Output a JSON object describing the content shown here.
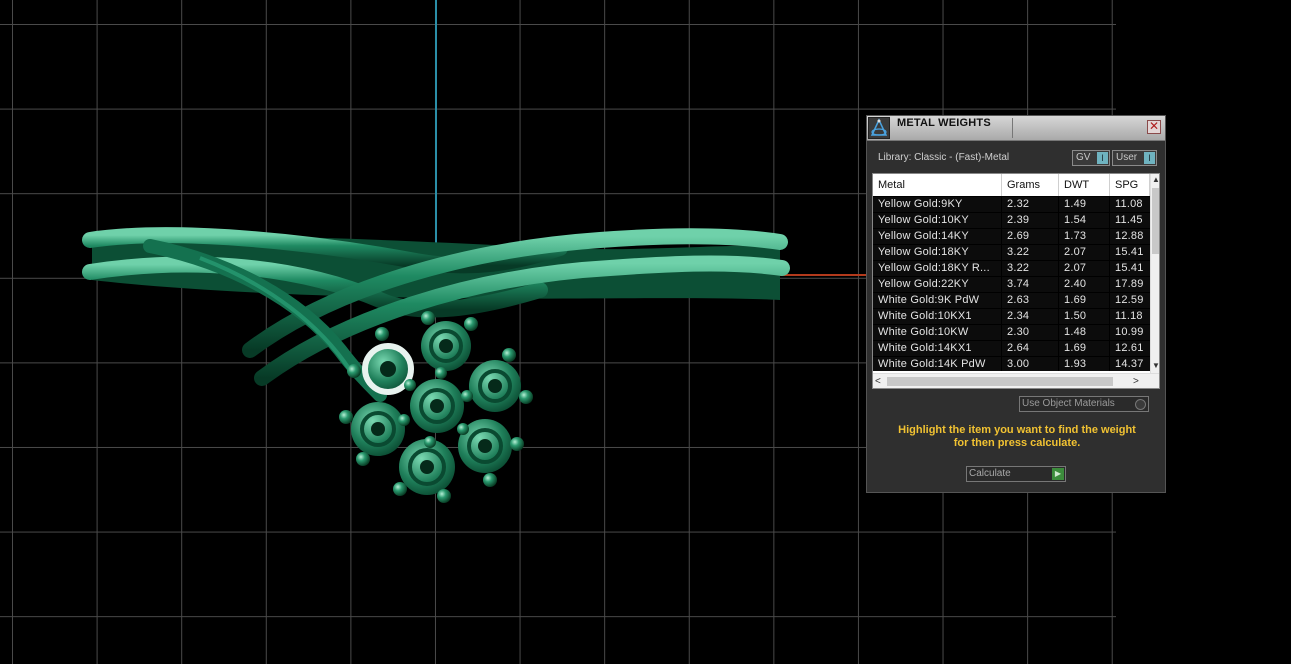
{
  "panel": {
    "title": "METAL WEIGHTS",
    "close_glyph": "✕",
    "library_label": "Library: Classic - (Fast)-Metal",
    "gv_toggle": "GV",
    "user_toggle": "User",
    "toggle_indicator": "I",
    "table": {
      "headers": {
        "metal": "Metal",
        "grams": "Grams",
        "dwt": "DWT",
        "spg": "SPG"
      },
      "rows": [
        {
          "metal": "Yellow Gold:9KY",
          "grams": "2.32",
          "dwt": "1.49",
          "spg": "11.08"
        },
        {
          "metal": "Yellow Gold:10KY",
          "grams": "2.39",
          "dwt": "1.54",
          "spg": "11.45"
        },
        {
          "metal": "Yellow Gold:14KY",
          "grams": "2.69",
          "dwt": "1.73",
          "spg": "12.88"
        },
        {
          "metal": "Yellow Gold:18KY",
          "grams": "3.22",
          "dwt": "2.07",
          "spg": "15.41"
        },
        {
          "metal": "Yellow Gold:18KY R...",
          "grams": "3.22",
          "dwt": "2.07",
          "spg": "15.41"
        },
        {
          "metal": "Yellow Gold:22KY",
          "grams": "3.74",
          "dwt": "2.40",
          "spg": "17.89"
        },
        {
          "metal": "White Gold:9K PdW",
          "grams": "2.63",
          "dwt": "1.69",
          "spg": "12.59"
        },
        {
          "metal": "White Gold:10KX1",
          "grams": "2.34",
          "dwt": "1.50",
          "spg": "11.18"
        },
        {
          "metal": "White Gold:10KW",
          "grams": "2.30",
          "dwt": "1.48",
          "spg": "10.99"
        },
        {
          "metal": "White Gold:14KX1",
          "grams": "2.64",
          "dwt": "1.69",
          "spg": "12.61"
        },
        {
          "metal": "White Gold:14K PdW",
          "grams": "3.00",
          "dwt": "1.93",
          "spg": "14.37"
        }
      ]
    },
    "scroll": {
      "up": "▲",
      "down": "▼",
      "left": "<",
      "right": ">"
    },
    "use_object_materials": "Use Object Materials",
    "instructions_line1": "Highlight the item you want to find the weight",
    "instructions_line2": "for then press calculate.",
    "calculate_label": "Calculate",
    "calculate_arrow": "▶"
  },
  "colors": {
    "model_green": "#1f7a57",
    "instruction_yellow": "#f1c232",
    "axis_blue": "#2b8fa8",
    "axis_red": "#b33a1c"
  }
}
